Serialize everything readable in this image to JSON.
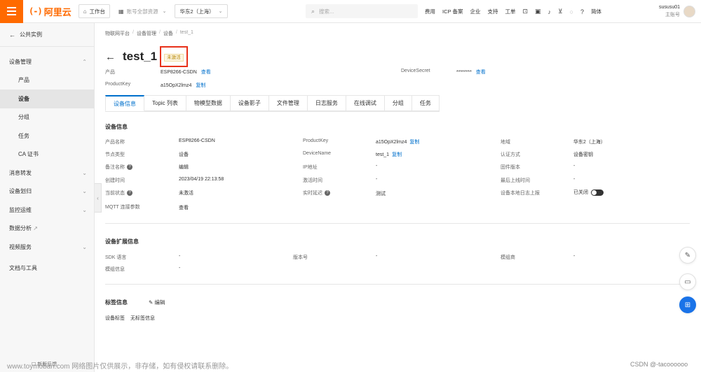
{
  "topbar": {
    "logo_mark": "(-)",
    "logo_text": "阿里云",
    "workbench": "工作台",
    "resources": "账号全部资源",
    "region": "华东2（上海）",
    "search_placeholder": "搜索...",
    "nav": [
      "费用",
      "ICP 备案",
      "企业",
      "支持",
      "工单"
    ],
    "lang": "简体",
    "user_name": "sususu01",
    "user_role": "主账号"
  },
  "sidebar": {
    "back": "公共实例",
    "items": [
      {
        "label": "设备管理"
      },
      {
        "label": "产品"
      },
      {
        "label": "设备"
      },
      {
        "label": "分组"
      },
      {
        "label": "任务"
      },
      {
        "label": "CA 证书"
      },
      {
        "label": "消息转发"
      },
      {
        "label": "设备划归"
      },
      {
        "label": "监控运维"
      },
      {
        "label": "数据分析"
      },
      {
        "label": "视频服务"
      },
      {
        "label": "文档与工具"
      }
    ],
    "bottom": "新版反馈"
  },
  "breadcrumb": [
    "物联网平台",
    "设备管理",
    "设备",
    "test_1"
  ],
  "title": "test_1",
  "status": "未激活",
  "header_info": {
    "product_label": "产品",
    "product_value": "ESP8266-CSDN",
    "view": "查看",
    "productkey_label": "ProductKey",
    "productkey_value": "a15OpX2lmz4",
    "copy": "复制",
    "secret_label": "DeviceSecret",
    "secret_value": "********"
  },
  "tabs": [
    "设备信息",
    "Topic 列表",
    "物模型数据",
    "设备影子",
    "文件管理",
    "日志服务",
    "在线调试",
    "分组",
    "任务"
  ],
  "device_info": {
    "title": "设备信息",
    "col1": [
      {
        "k": "产品名称",
        "v": "ESP8266-CSDN"
      },
      {
        "k": "节点类型",
        "v": "设备"
      },
      {
        "k": "备注名称",
        "v": "编辑"
      },
      {
        "k": "创建时间",
        "v": "2023/04/19 22:13:58"
      },
      {
        "k": "当前状态",
        "v": "未激活"
      },
      {
        "k": "MQTT 连接参数",
        "v": "查看"
      }
    ],
    "col2": [
      {
        "k": "ProductKey",
        "v": "a15OpX2lmz4"
      },
      {
        "k": "DeviceName",
        "v": "test_1"
      },
      {
        "k": "IP地址",
        "v": "-"
      },
      {
        "k": "激活时间",
        "v": "-"
      },
      {
        "k": "实时延迟",
        "v": "测试"
      }
    ],
    "col3": [
      {
        "k": "地域",
        "v": "华东2（上海）"
      },
      {
        "k": "认证方式",
        "v": "设备密钥"
      },
      {
        "k": "固件版本",
        "v": "-"
      },
      {
        "k": "最后上线时间",
        "v": "-"
      },
      {
        "k": "设备本地日志上报",
        "v": "已关闭"
      }
    ]
  },
  "ext_info": {
    "title": "设备扩展信息",
    "rows": [
      {
        "k": "SDK 语言",
        "v": "-"
      },
      {
        "k": "版本号",
        "v": "-"
      },
      {
        "k": "模组商",
        "v": "-"
      },
      {
        "k": "模组信息",
        "v": "-"
      }
    ]
  },
  "tags": {
    "title": "标签信息",
    "edit": "编辑",
    "label": "设备标签",
    "value": "无标签信息"
  },
  "watermark": "www.toymoban.com 网络图片仅供展示，非存储，如有侵权请联系删除。",
  "csdn": "CSDN @-tacoooooo"
}
